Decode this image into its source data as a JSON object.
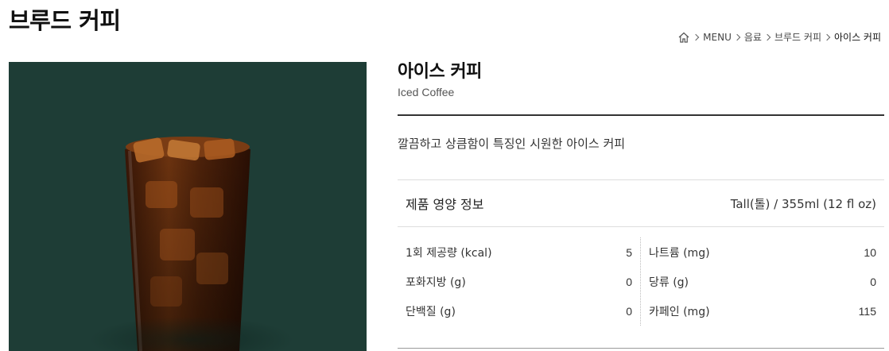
{
  "page": {
    "title": "브루드 커피"
  },
  "breadcrumb": {
    "home_icon": "home-icon",
    "items": [
      "MENU",
      "음료",
      "브루드 커피",
      "아이스 커피"
    ]
  },
  "product": {
    "image_alt": "Iced Coffee",
    "name": "아이스 커피",
    "name_en": "Iced Coffee",
    "description": "깔끔하고 상큼함이 특징인 시원한 아이스 커피"
  },
  "nutrition": {
    "title": "제품 영양 정보",
    "serving_size": "Tall(톨) / 355ml (12 fl oz)",
    "left": [
      {
        "label": "1회 제공량 (kcal)",
        "value": "5"
      },
      {
        "label": "포화지방 (g)",
        "value": "0"
      },
      {
        "label": "단백질 (g)",
        "value": "0"
      }
    ],
    "right": [
      {
        "label": "나트륨 (mg)",
        "value": "10"
      },
      {
        "label": "당류 (g)",
        "value": "0"
      },
      {
        "label": "카페인 (mg)",
        "value": "115"
      }
    ]
  },
  "colors": {
    "image_background": "#1e3d36",
    "coffee": "#5a2a0e"
  }
}
